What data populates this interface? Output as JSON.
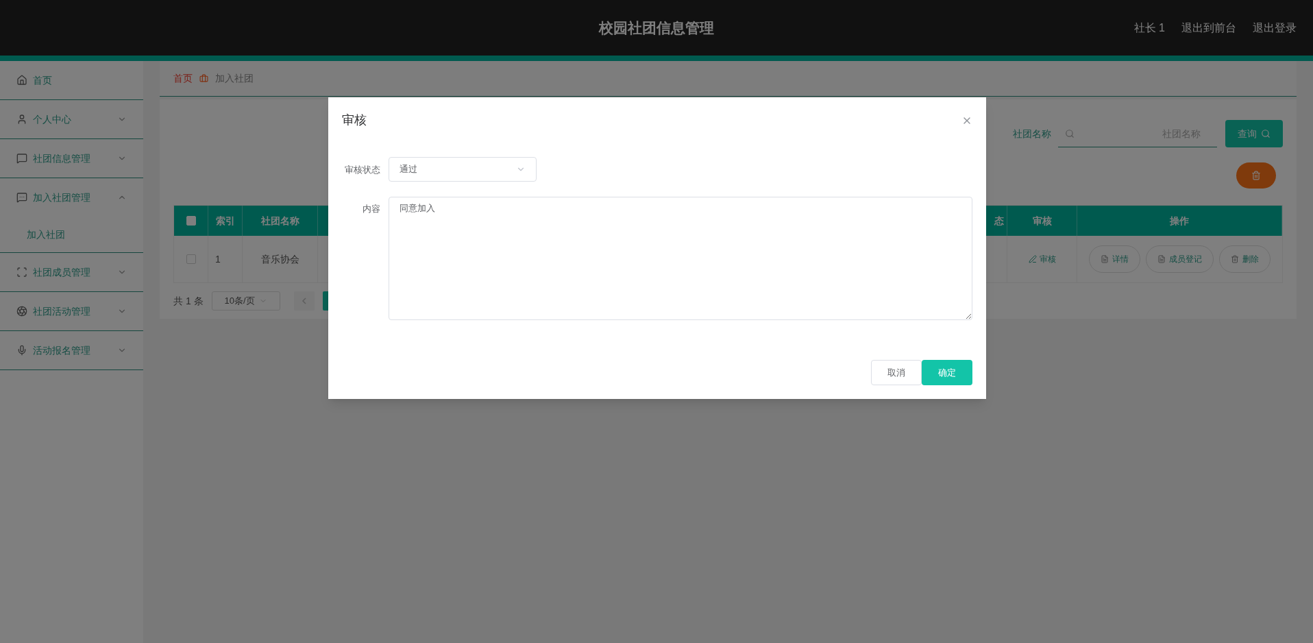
{
  "header": {
    "title": "校园社团信息管理",
    "links": [
      "社长 1",
      "退出到前台",
      "退出登录"
    ]
  },
  "sidebar": {
    "items": [
      {
        "label": "首页",
        "kind": "link"
      },
      {
        "label": "个人中心",
        "kind": "menu",
        "expanded": false
      },
      {
        "label": "社团信息管理",
        "kind": "menu",
        "expanded": false
      },
      {
        "label": "加入社团管理",
        "kind": "menu",
        "expanded": true,
        "children": [
          {
            "label": "加入社团"
          }
        ]
      },
      {
        "label": "社团成员管理",
        "kind": "menu",
        "expanded": false
      },
      {
        "label": "社团活动管理",
        "kind": "menu",
        "expanded": false
      },
      {
        "label": "活动报名管理",
        "kind": "menu",
        "expanded": false
      }
    ]
  },
  "breadcrumb": {
    "home": "首页",
    "current": "加入社团"
  },
  "search": {
    "label": "社团名称",
    "placeholder": "社团名称",
    "button": "查询"
  },
  "table": {
    "all_checked": false,
    "columns": [
      {
        "kind": "checkbox"
      },
      {
        "kind": "text",
        "label": "索引"
      },
      {
        "kind": "text",
        "label": "社团名称"
      },
      {
        "kind": "cut",
        "label": "态"
      },
      {
        "kind": "text",
        "label": "审核"
      },
      {
        "kind": "text",
        "label": "操作"
      }
    ],
    "rows": [
      {
        "checked": false,
        "cells": [
          "",
          "1",
          "音乐协会"
        ],
        "review": "审核",
        "actions": [
          "详情",
          "成员登记",
          "删除"
        ]
      }
    ]
  },
  "pagination": {
    "total": "共 1 条",
    "page_size": "10条/页"
  },
  "dialog": {
    "title": "审核",
    "fields": [
      {
        "kind": "select",
        "label": "审核状态",
        "value": "通过"
      },
      {
        "kind": "textarea",
        "label": "内容",
        "value": "同意加入"
      }
    ],
    "buttons": [
      {
        "label": "取消",
        "primary": false
      },
      {
        "label": "确定",
        "primary": true
      }
    ]
  }
}
